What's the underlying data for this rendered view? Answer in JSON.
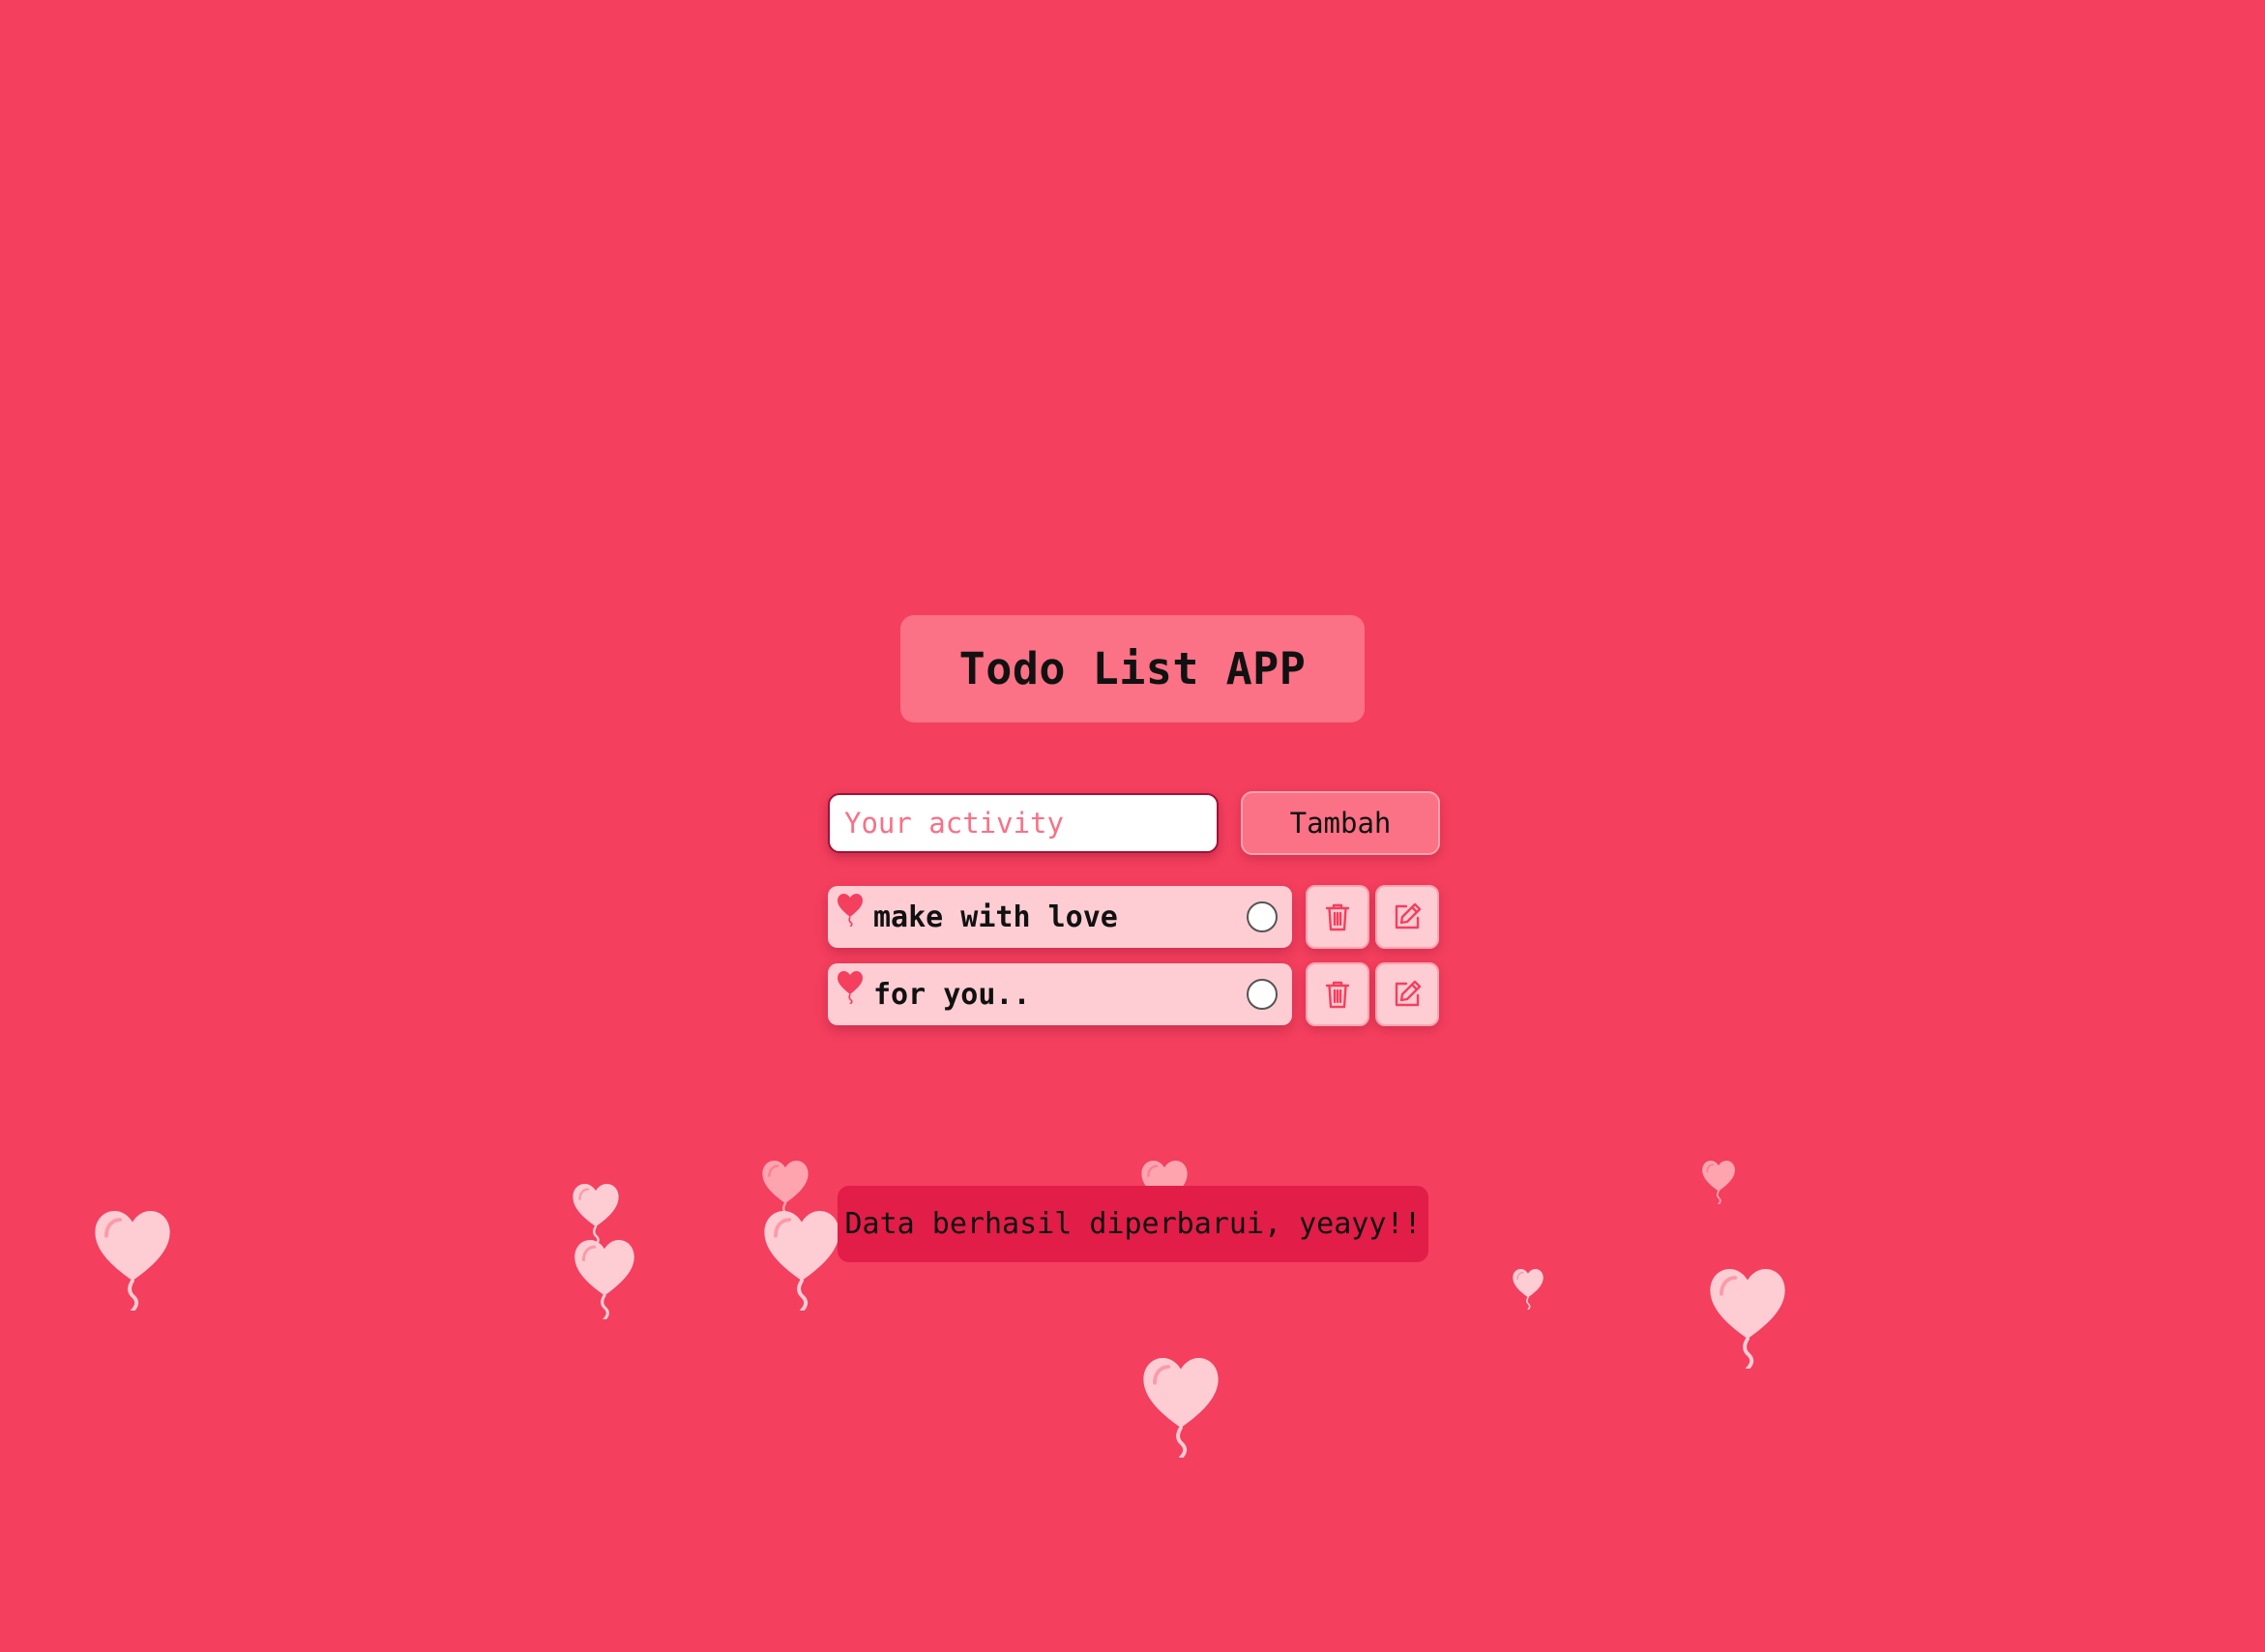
{
  "app": {
    "title": "Todo List APP"
  },
  "form": {
    "input_placeholder": "Your activity",
    "input_value": "",
    "add_button_label": "Tambah"
  },
  "todos": [
    {
      "text": "make with love",
      "done": false
    },
    {
      "text": "for you..",
      "done": false
    }
  ],
  "toast": {
    "message": "Data berhasil diperbarui, yeayy!!"
  },
  "icons": {
    "todo_marker": "heart-balloon-icon",
    "delete": "trash-icon",
    "edit": "edit-icon",
    "background_decoration": "heart-balloon-icon"
  },
  "colors": {
    "background": "#f43f5e",
    "title_box": "#fb7185",
    "todo_item": "#fecdd3",
    "toast": "#e11d48",
    "icon_accent": "#f43f5e",
    "balloon_light": "#fecdd3",
    "balloon_mid": "#fda4af"
  }
}
